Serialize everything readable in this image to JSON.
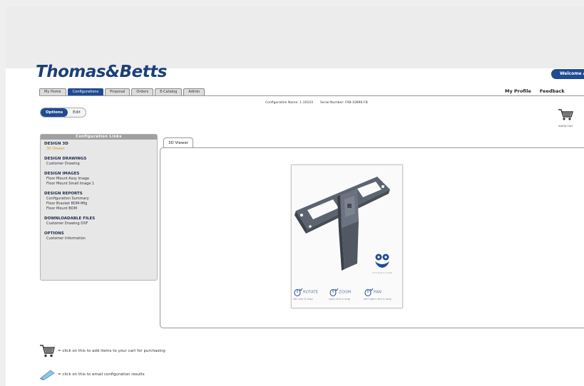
{
  "brand": {
    "logo_text": "Thomas&Betts"
  },
  "header": {
    "welcome": "Welcome A",
    "links": [
      "My Profile",
      "Feedback"
    ]
  },
  "tabs": [
    {
      "label": "My Home",
      "active": false
    },
    {
      "label": "Configurations",
      "active": true
    },
    {
      "label": "Proposal",
      "active": false
    },
    {
      "label": "Orders",
      "active": false
    },
    {
      "label": "E-Catalog",
      "active": false
    },
    {
      "label": "Admin",
      "active": false
    }
  ],
  "config_info": {
    "name": "Configuration Name: 1-10103",
    "serial": "Serial Number: FAB-10890-FB"
  },
  "mode_toggle": {
    "options_label": "Options",
    "edit_label": "Edit"
  },
  "cart_top": {
    "label": "Add to Cart",
    "icon": "cart-icon"
  },
  "sidebar": {
    "title": "Configuration Links",
    "sections": [
      {
        "title": "DESIGN 3D",
        "items": [
          {
            "label": "3D Viewer",
            "current": true
          }
        ]
      },
      {
        "title": "DESIGN DRAWINGS",
        "items": [
          {
            "label": "Customer Drawing"
          }
        ]
      },
      {
        "title": "DESIGN IMAGES",
        "items": [
          {
            "label": "Floor Mount Assy Image"
          },
          {
            "label": "Floor Mount Small Image 1"
          }
        ]
      },
      {
        "title": "DESIGN REPORTS",
        "items": [
          {
            "label": "Configuration Summary"
          },
          {
            "label": "Floor Bracket BOM-Mfg"
          },
          {
            "label": "Floor Mount BOM"
          }
        ]
      },
      {
        "title": "DOWNLOADABLE FILES",
        "items": [
          {
            "label": "Customer Drawing DXF"
          }
        ]
      },
      {
        "title": "OPTIONS",
        "items": [
          {
            "label": "Customer Information"
          }
        ]
      }
    ]
  },
  "viewer": {
    "tab_label": "3D Viewer",
    "controls": [
      {
        "label": "ROTATE",
        "hint": "left click & drag"
      },
      {
        "label": "ZOOM",
        "hint": "right click & drag"
      },
      {
        "label": "PAN",
        "hint": "left+right click & drag"
      }
    ],
    "badge_text": "click drag to rotate"
  },
  "legend": [
    {
      "icon": "cart-icon",
      "text": "= click on this to add items to your cart for purchasing"
    },
    {
      "icon": "email-icon",
      "text": "= click on this to email configuration results"
    }
  ],
  "colors": {
    "brand_blue": "#1f4b93",
    "accent_gold": "#d39b1e",
    "panel_gray": "#e7e7e7"
  }
}
